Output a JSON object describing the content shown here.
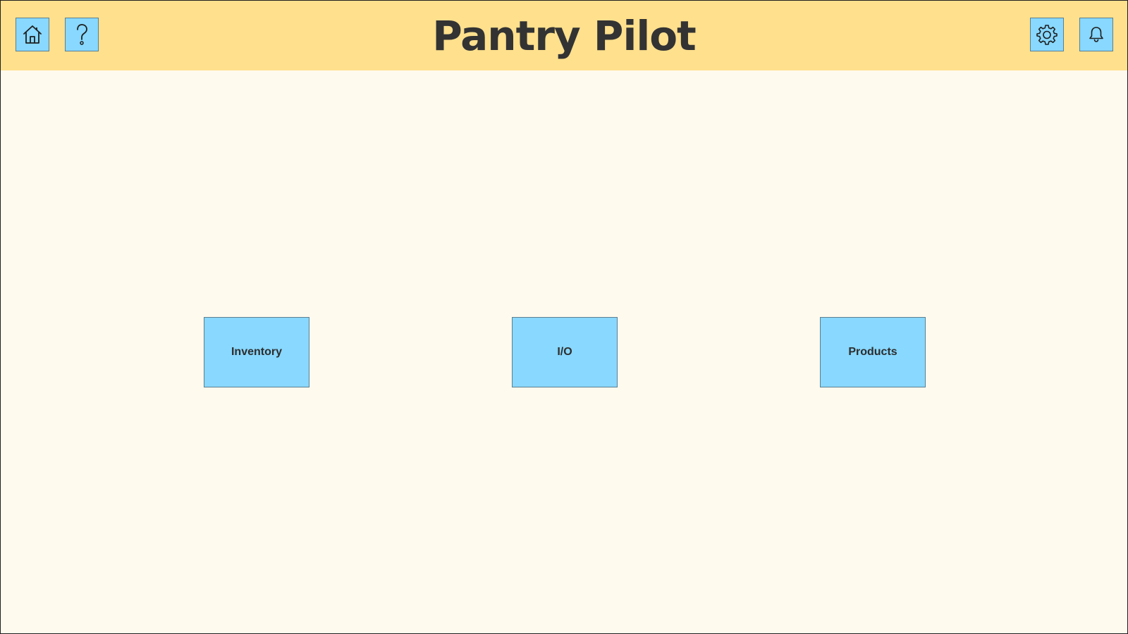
{
  "app": {
    "title": "Pantry Pilot"
  },
  "header": {
    "left_icons": [
      "home-icon",
      "help-icon"
    ],
    "right_icons": [
      "gear-icon",
      "bell-icon"
    ]
  },
  "main": {
    "buttons": [
      {
        "label": "Inventory"
      },
      {
        "label": "I/O"
      },
      {
        "label": "Products"
      }
    ]
  },
  "colors": {
    "header_bg": "#ffe08d",
    "page_bg": "#fffaee",
    "button_bg": "#88d8ff",
    "text": "#333333"
  }
}
